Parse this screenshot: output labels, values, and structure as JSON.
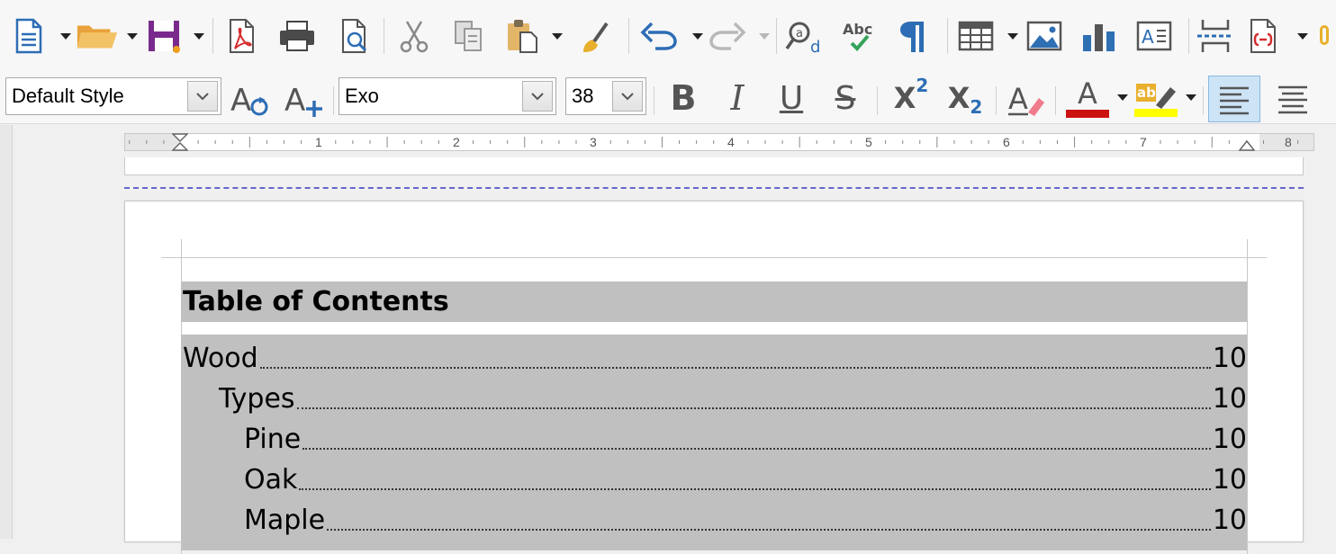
{
  "paragraph_style": {
    "value": "Default Style"
  },
  "font_name": {
    "value": "Exo"
  },
  "font_size": {
    "value": "38"
  },
  "ruler": {
    "numbers": [
      "1",
      "2",
      "3",
      "4",
      "5",
      "6",
      "7",
      "8"
    ]
  },
  "document": {
    "toc_title": "Table of Contents",
    "entries": [
      {
        "label": "Wood",
        "page": "10",
        "level": 1
      },
      {
        "label": "Types",
        "page": "10",
        "level": 2
      },
      {
        "label": "Pine",
        "page": "10",
        "level": 3
      },
      {
        "label": "Oak",
        "page": "10",
        "level": 3
      },
      {
        "label": "Maple",
        "page": "10",
        "level": 3
      }
    ]
  },
  "format_buttons": {
    "bold": "B",
    "italic": "I",
    "underline": "U",
    "strikethrough": "S",
    "superscript_base": "X",
    "superscript_exp": "2",
    "subscript_base": "X",
    "subscript_exp": "2",
    "font_color_letter": "A",
    "highlight_letters": "ab",
    "clear_format_letter": "A",
    "style_new_letter": "A",
    "spelling_letters": "Abc",
    "textbox_letter": "A"
  },
  "colors": {
    "save_purple": "#7a2a8c",
    "font_color_red": "#cc1111",
    "highlight_yellow": "#ffff00",
    "pdf_red": "#d42d2d",
    "open_folder": "#f0b64a",
    "brush_yellow": "#e8b02c",
    "chart_blue": "#2f6fb4",
    "page_break": "#6666cc",
    "toc_shade": "#c0c0c0",
    "align_active_bg": "#cde4f7"
  },
  "icons": {
    "new": "new-document-icon",
    "open": "open-folder-icon",
    "save": "save-floppy-icon",
    "export_pdf": "export-pdf-icon",
    "print": "printer-icon",
    "print_preview": "print-preview-icon",
    "cut": "scissors-icon",
    "copy": "copy-icon",
    "paste": "paste-clipboard-icon",
    "clone": "clone-formatting-brush-icon",
    "undo": "undo-arrow-icon",
    "redo": "redo-arrow-icon",
    "find": "find-replace-icon",
    "spelling": "spelling-check-icon",
    "formatting_marks": "pilcrow-icon",
    "table": "table-grid-icon",
    "image": "image-icon",
    "chart": "bar-chart-icon",
    "textbox": "text-box-icon",
    "page_break": "page-break-icon",
    "field": "insert-field-icon"
  }
}
